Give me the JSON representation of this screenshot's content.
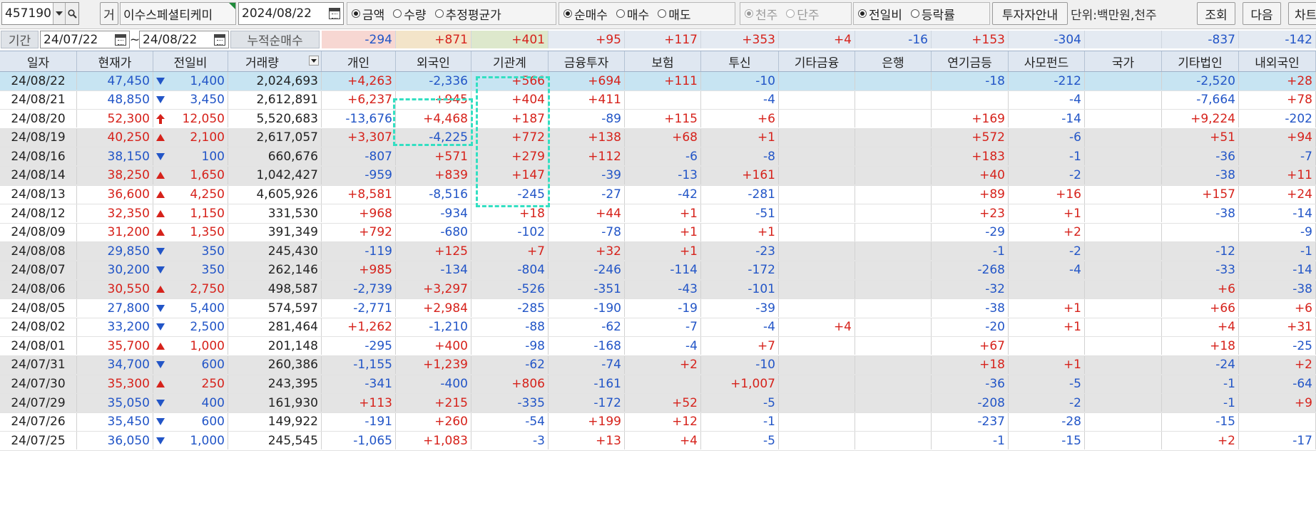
{
  "toolbar": {
    "stock_code": "457190",
    "market_tag": "거",
    "stock_name": "이수스페셜티케미",
    "date": "2024/08/22",
    "value_type": [
      "금액",
      "수량",
      "추정평균가"
    ],
    "trade_type": [
      "순매수",
      "매수",
      "매도"
    ],
    "unit_scale": [
      "천주",
      "단주"
    ],
    "compare_type": [
      "전일비",
      "등락률"
    ],
    "investor_info_button": "투자자안내",
    "unit_label": "단위:백만원,천주",
    "search_button": "조회",
    "next_button": "다음",
    "chart_button": "차트"
  },
  "period": {
    "label": "기간",
    "start": "24/07/22",
    "separator": "~",
    "end": "24/08/22",
    "accum_label": "누적순매수",
    "accum_values": [
      "-294",
      "+871",
      "+401",
      "+95",
      "+117",
      "+353",
      "+4",
      "-16",
      "+153",
      "-304",
      "",
      "-837",
      "-142"
    ]
  },
  "columns": [
    "일자",
    "현재가",
    "전일비",
    "거래량",
    "개인",
    "외국인",
    "기관계",
    "금융투자",
    "보험",
    "투신",
    "기타금융",
    "은행",
    "연기금등",
    "사모펀드",
    "국가",
    "기타법인",
    "내외국인"
  ],
  "rows": [
    [
      "24/08/22",
      "47,450",
      "dn",
      "1,400",
      "2,024,693",
      "+4,263",
      "-2,336",
      "+566",
      "+694",
      "+111",
      "-10",
      "",
      "",
      "-18",
      "-212",
      "",
      "-2,520",
      "+28"
    ],
    [
      "24/08/21",
      "48,850",
      "dn",
      "3,450",
      "2,612,891",
      "+6,237",
      "+945",
      "+404",
      "+411",
      "",
      "-4",
      "",
      "",
      "",
      "-4",
      "",
      "-7,664",
      "+78"
    ],
    [
      "24/08/20",
      "52,300",
      "limit",
      "12,050",
      "5,520,683",
      "-13,676",
      "+4,468",
      "+187",
      "-89",
      "+115",
      "+6",
      "",
      "",
      "+169",
      "-14",
      "",
      "+9,224",
      "-202"
    ],
    [
      "24/08/19",
      "40,250",
      "up",
      "2,100",
      "2,617,057",
      "+3,307",
      "-4,225",
      "+772",
      "+138",
      "+68",
      "+1",
      "",
      "",
      "+572",
      "-6",
      "",
      "+51",
      "+94"
    ],
    [
      "24/08/16",
      "38,150",
      "dn",
      "100",
      "660,676",
      "-807",
      "+571",
      "+279",
      "+112",
      "-6",
      "-8",
      "",
      "",
      "+183",
      "-1",
      "",
      "-36",
      "-7"
    ],
    [
      "24/08/14",
      "38,250",
      "up",
      "1,650",
      "1,042,427",
      "-959",
      "+839",
      "+147",
      "-39",
      "-13",
      "+161",
      "",
      "",
      "+40",
      "-2",
      "",
      "-38",
      "+11"
    ],
    [
      "24/08/13",
      "36,600",
      "up",
      "4,250",
      "4,605,926",
      "+8,581",
      "-8,516",
      "-245",
      "-27",
      "-42",
      "-281",
      "",
      "",
      "+89",
      "+16",
      "",
      "+157",
      "+24"
    ],
    [
      "24/08/12",
      "32,350",
      "up",
      "1,150",
      "331,530",
      "+968",
      "-934",
      "+18",
      "+44",
      "+1",
      "-51",
      "",
      "",
      "+23",
      "+1",
      "",
      "-38",
      "-14"
    ],
    [
      "24/08/09",
      "31,200",
      "up",
      "1,350",
      "391,349",
      "+792",
      "-680",
      "-102",
      "-78",
      "+1",
      "+1",
      "",
      "",
      "-29",
      "+2",
      "",
      "",
      "-9"
    ],
    [
      "24/08/08",
      "29,850",
      "dn",
      "350",
      "245,430",
      "-119",
      "+125",
      "+7",
      "+32",
      "+1",
      "-23",
      "",
      "",
      "-1",
      "-2",
      "",
      "-12",
      "-1"
    ],
    [
      "24/08/07",
      "30,200",
      "dn",
      "350",
      "262,146",
      "+985",
      "-134",
      "-804",
      "-246",
      "-114",
      "-172",
      "",
      "",
      "-268",
      "-4",
      "",
      "-33",
      "-14"
    ],
    [
      "24/08/06",
      "30,550",
      "up",
      "2,750",
      "498,587",
      "-2,739",
      "+3,297",
      "-526",
      "-351",
      "-43",
      "-101",
      "",
      "",
      "-32",
      "",
      "",
      "+6",
      "-38"
    ],
    [
      "24/08/05",
      "27,800",
      "dn",
      "5,400",
      "574,597",
      "-2,771",
      "+2,984",
      "-285",
      "-190",
      "-19",
      "-39",
      "",
      "",
      "-38",
      "+1",
      "",
      "+66",
      "+6"
    ],
    [
      "24/08/02",
      "33,200",
      "dn",
      "2,500",
      "281,464",
      "+1,262",
      "-1,210",
      "-88",
      "-62",
      "-7",
      "-4",
      "+4",
      "",
      "-20",
      "+1",
      "",
      "+4",
      "+31"
    ],
    [
      "24/08/01",
      "35,700",
      "up",
      "1,000",
      "201,148",
      "-295",
      "+400",
      "-98",
      "-168",
      "-4",
      "+7",
      "",
      "",
      "+67",
      "",
      "",
      "+18",
      "-25"
    ],
    [
      "24/07/31",
      "34,700",
      "dn",
      "600",
      "260,386",
      "-1,155",
      "+1,239",
      "-62",
      "-74",
      "+2",
      "-10",
      "",
      "",
      "+18",
      "+1",
      "",
      "-24",
      "+2"
    ],
    [
      "24/07/30",
      "35,300",
      "up",
      "250",
      "243,395",
      "-341",
      "-400",
      "+806",
      "-161",
      "",
      "+1,007",
      "",
      "",
      "-36",
      "-5",
      "",
      "-1",
      "-64"
    ],
    [
      "24/07/29",
      "35,050",
      "dn",
      "400",
      "161,930",
      "+113",
      "+215",
      "-335",
      "-172",
      "+52",
      "-5",
      "",
      "",
      "-208",
      "-2",
      "",
      "-1",
      "+9"
    ],
    [
      "24/07/26",
      "35,450",
      "dn",
      "600",
      "149,922",
      "-191",
      "+260",
      "-54",
      "+199",
      "+12",
      "-1",
      "",
      "",
      "-237",
      "-28",
      "",
      "-15",
      ""
    ],
    [
      "24/07/25",
      "36,050",
      "dn",
      "1,000",
      "245,545",
      "-1,065",
      "+1,083",
      "-3",
      "+13",
      "+4",
      "-5",
      "",
      "",
      "-1",
      "-15",
      "",
      "+2",
      "-17"
    ]
  ],
  "colors": {
    "up": "#d6221b",
    "down": "#2255c7",
    "selected_row": "#c7e4f2",
    "highlight": "#33dfc2"
  }
}
